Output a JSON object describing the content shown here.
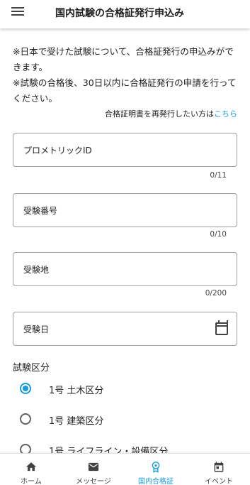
{
  "header": {
    "menu_icon": "hamburger-menu-icon",
    "title": "国内試験の合格証発行申込み"
  },
  "notice": {
    "line1": "※日本で受けた試験について、合格証発行の申込みができます。",
    "line2": "※試験の合格後、30日以内に合格証発行の申請を行ってください。"
  },
  "reissue": {
    "text": "合格証明書を再発行したい方は",
    "link": "こちら",
    "link_color": "#1a9bd7"
  },
  "form": {
    "prometric_id": {
      "label": "プロメトリックID",
      "value": "",
      "counter": "0/11"
    },
    "exam_number": {
      "label": "受験番号",
      "value": "",
      "counter": "0/10"
    },
    "exam_location": {
      "label": "受験地",
      "value": "",
      "counter": "0/200"
    },
    "exam_date": {
      "label": "受験日",
      "value": "",
      "icon": "calendar-icon"
    },
    "category": {
      "label": "試験区分",
      "options": [
        {
          "label": "1号 土木区分",
          "selected": true
        },
        {
          "label": "1号 建築区分",
          "selected": false
        },
        {
          "label": "1号 ライフライン・設備区分",
          "selected": false
        }
      ]
    }
  },
  "bottom_nav": {
    "items": [
      {
        "label": "ホーム",
        "icon": "home-icon",
        "active": false
      },
      {
        "label": "メッセージ",
        "icon": "mail-icon",
        "active": false
      },
      {
        "label": "国内合格証",
        "icon": "award-icon",
        "active": true
      },
      {
        "label": "イベント",
        "icon": "event-calendar-icon",
        "active": false
      }
    ]
  },
  "colors": {
    "accent": "#1a9bd7",
    "text": "#212121",
    "border": "#9e9e9e"
  }
}
